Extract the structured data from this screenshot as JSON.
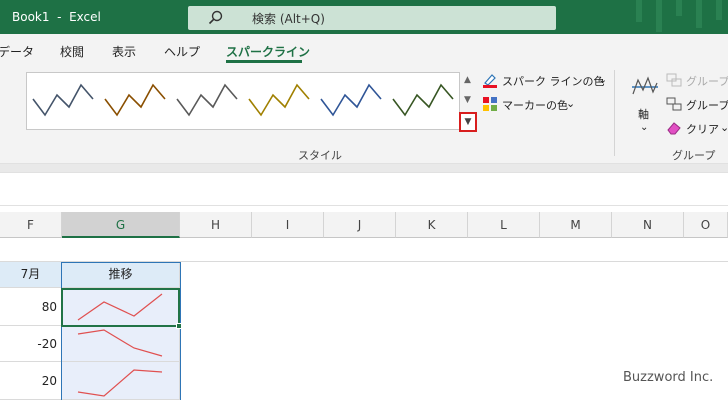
{
  "window": {
    "title": "Book1  -  Excel"
  },
  "search": {
    "placeholder": "検索 (Alt+Q)"
  },
  "tabs": [
    {
      "label": "データ",
      "active": false
    },
    {
      "label": "校閲",
      "active": false
    },
    {
      "label": "表示",
      "active": false
    },
    {
      "label": "ヘルプ",
      "active": false
    },
    {
      "label": "スパークライン",
      "active": true
    }
  ],
  "ribbon": {
    "style_group_label": "スタイル",
    "group_group_label": "グループ",
    "sparkline_color_label": "スパーク ラインの色",
    "marker_color_label": "マーカーの色",
    "axis_label": "軸",
    "group_cmd_label": "グループ化",
    "ungroup_cmd_label": "グループ解除",
    "clear_label": "クリア",
    "style_colors": [
      "#44546a",
      "#8a4f00",
      "#595959",
      "#a08000",
      "#2f5597",
      "#375623"
    ]
  },
  "grid": {
    "columns": [
      "F",
      "G",
      "H",
      "I",
      "J",
      "K",
      "L",
      "M",
      "N",
      "O"
    ],
    "selected_column": "G",
    "header_row": {
      "F": "7月",
      "G": "推移"
    },
    "rows": [
      {
        "F": "80"
      },
      {
        "F": "-20"
      },
      {
        "F": "20"
      }
    ],
    "sparkline_color": "#e05050"
  },
  "watermark": "Buzzword Inc."
}
